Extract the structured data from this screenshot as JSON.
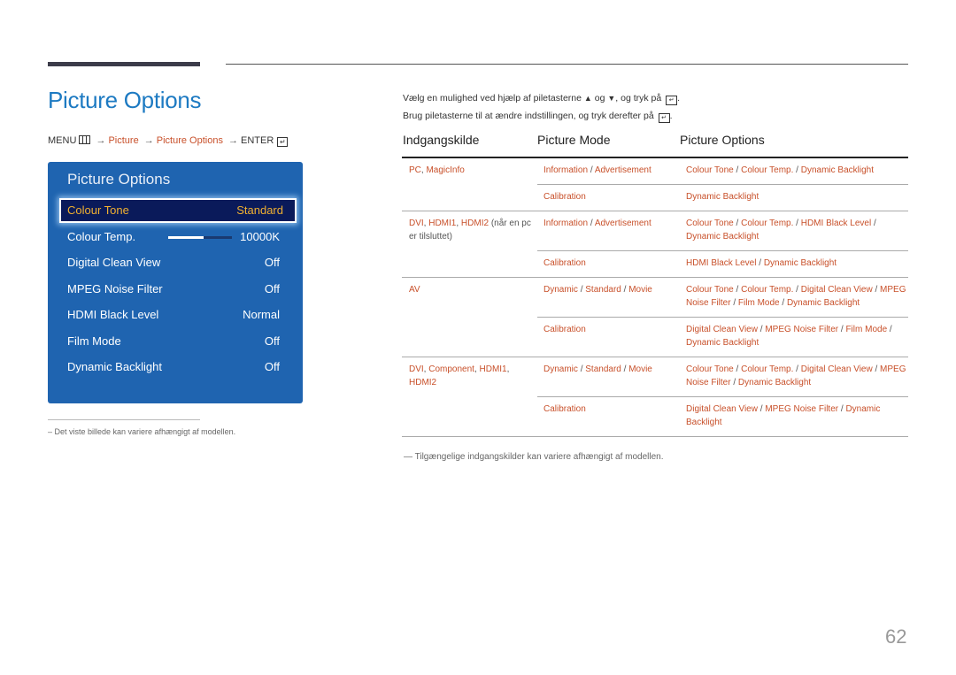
{
  "page": {
    "title": "Picture Options",
    "page_number": "62"
  },
  "breadcrumb": {
    "menu": "MENU",
    "arrow": "→",
    "items": [
      "Picture",
      "Picture Options"
    ],
    "enter": "ENTER"
  },
  "panel": {
    "title": "Picture Options",
    "rows": [
      {
        "label": "Colour Tone",
        "value": "Standard",
        "selected": true
      },
      {
        "label": "Colour Temp.",
        "value": "10000K",
        "slider_fraction": 0.55
      },
      {
        "label": "Digital Clean View",
        "value": "Off"
      },
      {
        "label": "MPEG Noise Filter",
        "value": "Off"
      },
      {
        "label": "HDMI Black Level",
        "value": "Normal"
      },
      {
        "label": "Film Mode",
        "value": "Off"
      },
      {
        "label": "Dynamic Backlight",
        "value": "Off"
      }
    ]
  },
  "left_footnote": "–  Det viste billede kan variere afhængigt af modellen.",
  "instructions": {
    "line1_a": "Vælg en mulighed ved hjælp af piletasterne",
    "line1_b": "og",
    "line1_c": ", og tryk på",
    "line2": "Brug piletasterne til at ændre indstillingen, og tryk derefter på",
    "up_glyph": "▲",
    "down_glyph": "▼"
  },
  "table": {
    "headers": [
      "Indgangskilde",
      "Picture Mode",
      "Picture Options"
    ],
    "groups": [
      {
        "source": [
          "PC",
          "MagicInfo"
        ],
        "source_suffix": "",
        "rows": [
          {
            "modes": [
              "Information",
              "Advertisement"
            ],
            "options": [
              "Colour Tone",
              "Colour Temp.",
              "Dynamic Backlight"
            ]
          },
          {
            "modes": [
              "Calibration"
            ],
            "options": [
              "Dynamic Backlight"
            ]
          }
        ]
      },
      {
        "source": [
          "DVI",
          "HDMI1",
          "HDMI2"
        ],
        "source_suffix": " (når en pc er tilsluttet)",
        "rows": [
          {
            "modes": [
              "Information",
              "Advertisement"
            ],
            "options": [
              "Colour Tone",
              "Colour Temp.",
              "HDMI Black Level",
              "Dynamic Backlight"
            ]
          },
          {
            "modes": [
              "Calibration"
            ],
            "options": [
              "HDMI Black Level",
              "Dynamic Backlight"
            ]
          }
        ]
      },
      {
        "source": [
          "AV"
        ],
        "source_suffix": "",
        "rows": [
          {
            "modes": [
              "Dynamic",
              "Standard",
              "Movie"
            ],
            "options": [
              "Colour Tone",
              "Colour Temp.",
              "Digital Clean View",
              "MPEG Noise Filter",
              "Film Mode",
              "Dynamic Backlight"
            ]
          },
          {
            "modes": [
              "Calibration"
            ],
            "options": [
              "Digital Clean View",
              "MPEG Noise Filter",
              "Film Mode",
              "Dynamic Backlight"
            ]
          }
        ]
      },
      {
        "source": [
          "DVI",
          "Component",
          "HDMI1",
          "HDMI2"
        ],
        "source_suffix": "",
        "rows": [
          {
            "modes": [
              "Dynamic",
              "Standard",
              "Movie"
            ],
            "options": [
              "Colour Tone",
              "Colour Temp.",
              "Digital Clean View",
              "MPEG Noise Filter",
              "Dynamic Backlight"
            ]
          },
          {
            "modes": [
              "Calibration"
            ],
            "options": [
              "Digital Clean View",
              "MPEG Noise Filter",
              "Dynamic Backlight"
            ]
          }
        ]
      }
    ]
  },
  "right_footnote": "Tilgængelige indgangskilder kan variere afhængigt af modellen.",
  "colors": {
    "title_blue": "#1d7ac2",
    "link_orange": "#c8502a",
    "panel_blue": "#1f64b0",
    "selected_bg": "#0a1a5a",
    "selected_text": "#f0b030"
  }
}
